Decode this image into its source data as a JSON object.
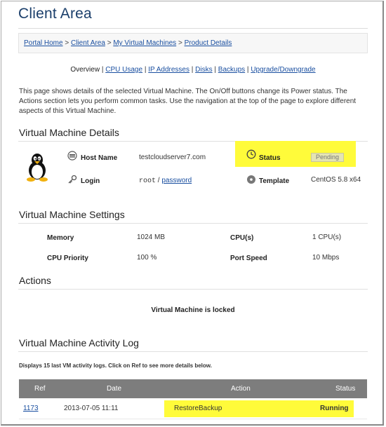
{
  "page": {
    "title": "Client Area"
  },
  "breadcrumb": {
    "items": [
      "Portal Home",
      "Client Area",
      "My Virtual Machines",
      "Product Details"
    ],
    "separator": ">"
  },
  "subnav": {
    "items": [
      "Overview",
      "CPU Usage",
      "IP Addresses",
      "Disks",
      "Backups",
      "Upgrade/Downgrade"
    ],
    "separator": "|"
  },
  "intro": "This page shows details of the selected Virtual Machine. The On/Off buttons change its Power status. The Actions section lets you perform common tasks. Use the navigation at the top of the page to explore different aspects of this Virtual Machine.",
  "details": {
    "heading": "Virtual Machine Details",
    "host_name_label": "Host Name",
    "host_name_value": "testcloudserver7.com",
    "login_label": "Login",
    "login_user": "root",
    "login_separator": "/",
    "login_password_link": "password",
    "status_label": "Status",
    "status_value": "Pending",
    "template_label": "Template",
    "template_value": "CentOS 5.8 x64"
  },
  "settings": {
    "heading": "Virtual Machine Settings",
    "memory_label": "Memory",
    "memory_value": "1024 MB",
    "cpus_label": "CPU(s)",
    "cpus_value": "1 CPU(s)",
    "cpu_priority_label": "CPU Priority",
    "cpu_priority_value": "100 %",
    "port_speed_label": "Port Speed",
    "port_speed_value": "10 Mbps"
  },
  "actions": {
    "heading": "Actions",
    "locked_message": "Virtual Machine is locked"
  },
  "log": {
    "heading": "Virtual Machine Activity Log",
    "note": "Displays 15 last VM activity logs. Click on Ref to see more details below.",
    "columns": [
      "Ref",
      "Date",
      "Action",
      "Status"
    ],
    "rows": [
      {
        "ref": "1173",
        "date": "2013-07-05 11:11",
        "action": "RestoreBackup",
        "status": "Running"
      }
    ]
  },
  "colors": {
    "title": "#1b3f6b",
    "link": "#1a4fa0",
    "highlight": "#fffb3a",
    "table_header": "#7d7d7d"
  },
  "icons": [
    "linux-penguin-logo",
    "server-icon",
    "key-icon",
    "clock-icon",
    "disc-icon"
  ]
}
